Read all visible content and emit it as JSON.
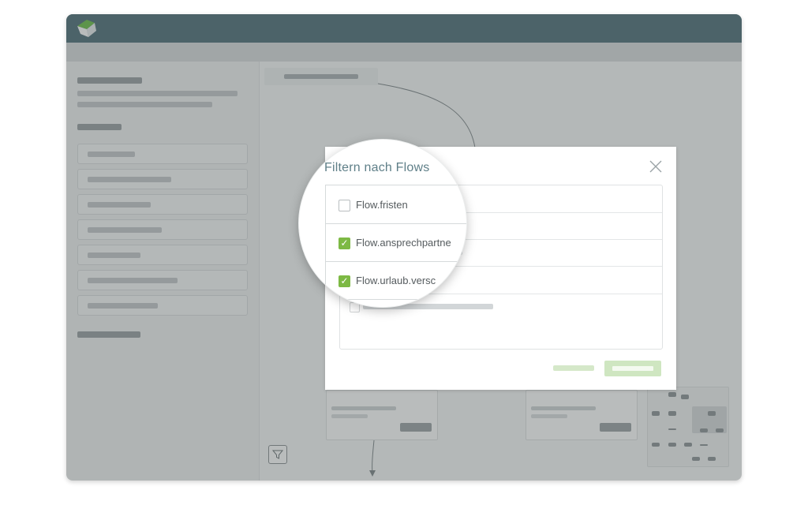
{
  "app": {
    "logo_icon": "leaf-logo-icon"
  },
  "filter_dialog": {
    "title": "Filtern nach Flows",
    "close_icon": "close-icon",
    "options": [
      {
        "label": "Flow.fristen",
        "checked": false
      },
      {
        "label": "Flow.ansprechpartne",
        "checked": true
      },
      {
        "label": "Flow.urlaub.versc",
        "checked": true
      }
    ],
    "check_glyph": "✓"
  },
  "canvas": {
    "filter_icon": "funnel-icon"
  },
  "colors": {
    "titlebar": "#50707a",
    "accent_green": "#7db944",
    "title_text": "#5f7f88"
  }
}
